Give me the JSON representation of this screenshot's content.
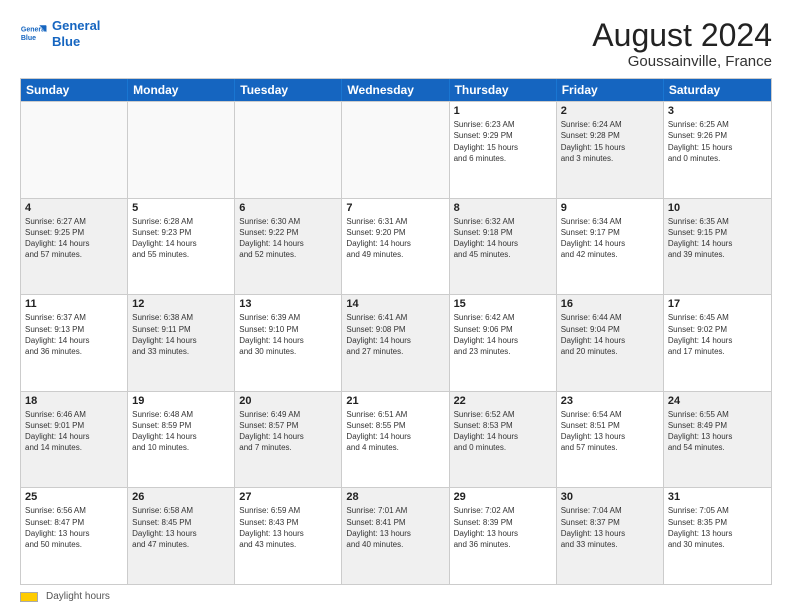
{
  "logo": {
    "line1": "General",
    "line2": "Blue"
  },
  "title": "August 2024",
  "subtitle": "Goussainville, France",
  "weekdays": [
    "Sunday",
    "Monday",
    "Tuesday",
    "Wednesday",
    "Thursday",
    "Friday",
    "Saturday"
  ],
  "rows": [
    [
      {
        "day": "",
        "text": "",
        "empty": true
      },
      {
        "day": "",
        "text": "",
        "empty": true
      },
      {
        "day": "",
        "text": "",
        "empty": true
      },
      {
        "day": "",
        "text": "",
        "empty": true
      },
      {
        "day": "1",
        "text": "Sunrise: 6:23 AM\nSunset: 9:29 PM\nDaylight: 15 hours\nand 6 minutes."
      },
      {
        "day": "2",
        "text": "Sunrise: 6:24 AM\nSunset: 9:28 PM\nDaylight: 15 hours\nand 3 minutes.",
        "shaded": true
      },
      {
        "day": "3",
        "text": "Sunrise: 6:25 AM\nSunset: 9:26 PM\nDaylight: 15 hours\nand 0 minutes."
      }
    ],
    [
      {
        "day": "4",
        "text": "Sunrise: 6:27 AM\nSunset: 9:25 PM\nDaylight: 14 hours\nand 57 minutes.",
        "shaded": true
      },
      {
        "day": "5",
        "text": "Sunrise: 6:28 AM\nSunset: 9:23 PM\nDaylight: 14 hours\nand 55 minutes."
      },
      {
        "day": "6",
        "text": "Sunrise: 6:30 AM\nSunset: 9:22 PM\nDaylight: 14 hours\nand 52 minutes.",
        "shaded": true
      },
      {
        "day": "7",
        "text": "Sunrise: 6:31 AM\nSunset: 9:20 PM\nDaylight: 14 hours\nand 49 minutes."
      },
      {
        "day": "8",
        "text": "Sunrise: 6:32 AM\nSunset: 9:18 PM\nDaylight: 14 hours\nand 45 minutes.",
        "shaded": true
      },
      {
        "day": "9",
        "text": "Sunrise: 6:34 AM\nSunset: 9:17 PM\nDaylight: 14 hours\nand 42 minutes."
      },
      {
        "day": "10",
        "text": "Sunrise: 6:35 AM\nSunset: 9:15 PM\nDaylight: 14 hours\nand 39 minutes.",
        "shaded": true
      }
    ],
    [
      {
        "day": "11",
        "text": "Sunrise: 6:37 AM\nSunset: 9:13 PM\nDaylight: 14 hours\nand 36 minutes."
      },
      {
        "day": "12",
        "text": "Sunrise: 6:38 AM\nSunset: 9:11 PM\nDaylight: 14 hours\nand 33 minutes.",
        "shaded": true
      },
      {
        "day": "13",
        "text": "Sunrise: 6:39 AM\nSunset: 9:10 PM\nDaylight: 14 hours\nand 30 minutes."
      },
      {
        "day": "14",
        "text": "Sunrise: 6:41 AM\nSunset: 9:08 PM\nDaylight: 14 hours\nand 27 minutes.",
        "shaded": true
      },
      {
        "day": "15",
        "text": "Sunrise: 6:42 AM\nSunset: 9:06 PM\nDaylight: 14 hours\nand 23 minutes."
      },
      {
        "day": "16",
        "text": "Sunrise: 6:44 AM\nSunset: 9:04 PM\nDaylight: 14 hours\nand 20 minutes.",
        "shaded": true
      },
      {
        "day": "17",
        "text": "Sunrise: 6:45 AM\nSunset: 9:02 PM\nDaylight: 14 hours\nand 17 minutes."
      }
    ],
    [
      {
        "day": "18",
        "text": "Sunrise: 6:46 AM\nSunset: 9:01 PM\nDaylight: 14 hours\nand 14 minutes.",
        "shaded": true
      },
      {
        "day": "19",
        "text": "Sunrise: 6:48 AM\nSunset: 8:59 PM\nDaylight: 14 hours\nand 10 minutes."
      },
      {
        "day": "20",
        "text": "Sunrise: 6:49 AM\nSunset: 8:57 PM\nDaylight: 14 hours\nand 7 minutes.",
        "shaded": true
      },
      {
        "day": "21",
        "text": "Sunrise: 6:51 AM\nSunset: 8:55 PM\nDaylight: 14 hours\nand 4 minutes."
      },
      {
        "day": "22",
        "text": "Sunrise: 6:52 AM\nSunset: 8:53 PM\nDaylight: 14 hours\nand 0 minutes.",
        "shaded": true
      },
      {
        "day": "23",
        "text": "Sunrise: 6:54 AM\nSunset: 8:51 PM\nDaylight: 13 hours\nand 57 minutes."
      },
      {
        "day": "24",
        "text": "Sunrise: 6:55 AM\nSunset: 8:49 PM\nDaylight: 13 hours\nand 54 minutes.",
        "shaded": true
      }
    ],
    [
      {
        "day": "25",
        "text": "Sunrise: 6:56 AM\nSunset: 8:47 PM\nDaylight: 13 hours\nand 50 minutes."
      },
      {
        "day": "26",
        "text": "Sunrise: 6:58 AM\nSunset: 8:45 PM\nDaylight: 13 hours\nand 47 minutes.",
        "shaded": true
      },
      {
        "day": "27",
        "text": "Sunrise: 6:59 AM\nSunset: 8:43 PM\nDaylight: 13 hours\nand 43 minutes."
      },
      {
        "day": "28",
        "text": "Sunrise: 7:01 AM\nSunset: 8:41 PM\nDaylight: 13 hours\nand 40 minutes.",
        "shaded": true
      },
      {
        "day": "29",
        "text": "Sunrise: 7:02 AM\nSunset: 8:39 PM\nDaylight: 13 hours\nand 36 minutes."
      },
      {
        "day": "30",
        "text": "Sunrise: 7:04 AM\nSunset: 8:37 PM\nDaylight: 13 hours\nand 33 minutes.",
        "shaded": true
      },
      {
        "day": "31",
        "text": "Sunrise: 7:05 AM\nSunset: 8:35 PM\nDaylight: 13 hours\nand 30 minutes."
      }
    ]
  ],
  "footer": {
    "legend_label": "Daylight hours"
  }
}
